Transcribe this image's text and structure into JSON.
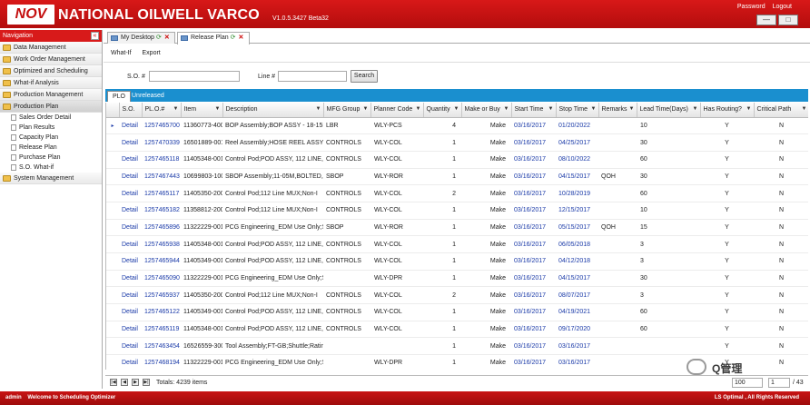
{
  "header": {
    "logo_text": "NOV",
    "company": "NATIONAL OILWELL VARCO",
    "version": "V1.0.5.3427 Beta32",
    "links": [
      "Password",
      "Logout"
    ],
    "window_controls": [
      "—",
      "□"
    ]
  },
  "navigation": {
    "title": "Navigation",
    "collapse": "«",
    "items": [
      {
        "label": "Data Management"
      },
      {
        "label": "Work Order Management"
      },
      {
        "label": "Optimized and Scheduling"
      },
      {
        "label": "What-if Analysis"
      },
      {
        "label": "Production Management"
      },
      {
        "label": "Production Plan",
        "active": true
      }
    ],
    "subitems": [
      "Sales Order Detail",
      "Plan Results",
      "Capacity Plan",
      "Release Plan",
      "Purchase Plan",
      "S.O. What-if"
    ],
    "bottom_item": "System Management"
  },
  "tabs": [
    {
      "label": "My Desktop",
      "refresh": "⟳",
      "close": "✕"
    },
    {
      "label": "Release Plan",
      "refresh": "⟳",
      "close": "✕"
    }
  ],
  "toolbar": {
    "whatif": "What-If",
    "export": "Export"
  },
  "filters": {
    "so_label": "S.O. #",
    "so_value": "",
    "line_label": "Line #",
    "line_value": "",
    "search_button": "Search"
  },
  "subtabs": [
    "PLO",
    "Unreleased"
  ],
  "grid": {
    "columns": [
      "S.O.",
      "PL.O.#",
      "Item",
      "Description",
      "MFG Group",
      "Planner Code",
      "Quantity",
      "Make or Buy",
      "Start Time",
      "Stop Time",
      "Remarks",
      "Lead Time(Days)",
      "Has Routing?",
      "Critical Path"
    ],
    "filter_icon": "▼",
    "rows": [
      [
        "Detail",
        "1257465700",
        "11360773-400",
        "BOP Assembly;BOP ASSY - 18-15M",
        "LBR",
        "WLY-PCS",
        "4",
        "Make",
        "03/16/2017",
        "01/20/2022",
        "",
        "10",
        "Y",
        "N"
      ],
      [
        "Detail",
        "1257470339",
        "16501889-001",
        "Reel Assembly;HOSE REEL ASSY, I",
        "CONTROLS",
        "WLY-COL",
        "1",
        "Make",
        "03/16/2017",
        "04/25/2017",
        "",
        "30",
        "Y",
        "N"
      ],
      [
        "Detail",
        "1257465118",
        "11405348-001",
        "Control Pod;POD ASSY, 112 LINE, I",
        "CONTROLS",
        "WLY-COL",
        "1",
        "Make",
        "03/16/2017",
        "08/10/2022",
        "",
        "60",
        "Y",
        "N"
      ],
      [
        "Detail",
        "1257467443",
        "10699803-100",
        "SBOP Assembly;11-05M,BOLTED,S",
        "SBOP",
        "WLY-ROR",
        "1",
        "Make",
        "03/16/2017",
        "04/15/2017",
        "QOH",
        "30",
        "Y",
        "N"
      ],
      [
        "Detail",
        "1257465117",
        "11405350-200",
        "Control Pod;112 Line MUX;Non-I",
        "CONTROLS",
        "WLY-COL",
        "2",
        "Make",
        "03/16/2017",
        "10/28/2019",
        "",
        "60",
        "Y",
        "N"
      ],
      [
        "Detail",
        "1257465182",
        "11358812-200",
        "Control Pod;112 Line MUX;Non-I",
        "CONTROLS",
        "WLY-COL",
        "1",
        "Make",
        "03/16/2017",
        "12/15/2017",
        "",
        "10",
        "Y",
        "N"
      ],
      [
        "Detail",
        "1257465896",
        "11322229-001",
        "PCG Engineering_EDM Use Only;S",
        "SBOP",
        "WLY-ROR",
        "1",
        "Make",
        "03/16/2017",
        "05/15/2017",
        "QOH",
        "15",
        "Y",
        "N"
      ],
      [
        "Detail",
        "1257465938",
        "11405348-001",
        "Control Pod;POD ASSY, 112 LINE, I",
        "CONTROLS",
        "WLY-COL",
        "1",
        "Make",
        "03/16/2017",
        "06/05/2018",
        "",
        "3",
        "Y",
        "N"
      ],
      [
        "Detail",
        "1257465944",
        "11405349-001",
        "Control Pod;POD ASSY, 112 LINE, I",
        "CONTROLS",
        "WLY-COL",
        "1",
        "Make",
        "03/16/2017",
        "04/12/2018",
        "",
        "3",
        "Y",
        "N"
      ],
      [
        "Detail",
        "1257465090",
        "11322229-001",
        "PCG Engineering_EDM Use Only;S",
        "",
        "WLY-DPR",
        "1",
        "Make",
        "03/16/2017",
        "04/15/2017",
        "",
        "30",
        "Y",
        "N"
      ],
      [
        "Detail",
        "1257465937",
        "11405350-200",
        "Control Pod;112 Line MUX;Non-I",
        "CONTROLS",
        "WLY-COL",
        "2",
        "Make",
        "03/16/2017",
        "08/07/2017",
        "",
        "3",
        "Y",
        "N"
      ],
      [
        "Detail",
        "1257465122",
        "11405349-001",
        "Control Pod;POD ASSY, 112 LINE, I",
        "CONTROLS",
        "WLY-COL",
        "1",
        "Make",
        "03/16/2017",
        "04/19/2021",
        "",
        "60",
        "Y",
        "N"
      ],
      [
        "Detail",
        "1257465119",
        "11405348-001",
        "Control Pod;POD ASSY, 112 LINE, I",
        "CONTROLS",
        "WLY-COL",
        "1",
        "Make",
        "03/16/2017",
        "09/17/2020",
        "",
        "60",
        "Y",
        "N"
      ],
      [
        "Detail",
        "1257463454",
        "16526559-300",
        "Tool Assembly;FT-GB;Shuttle;Rating",
        "",
        "",
        "1",
        "Make",
        "03/16/2017",
        "03/16/2017",
        "",
        "",
        "Y",
        "N"
      ],
      [
        "Detail",
        "1257468194",
        "11322229-001",
        "PCG Engineering_EDM Use Only;S",
        "",
        "WLY-DPR",
        "1",
        "Make",
        "03/16/2017",
        "03/16/2017",
        "",
        "",
        "Y",
        "N"
      ]
    ]
  },
  "pager": {
    "buttons": [
      "|◀",
      "◀",
      "▶",
      "▶|"
    ],
    "totals": "Totals: 4239 items",
    "page_size": "100",
    "page": "1",
    "page_count": "/ 43"
  },
  "footer": {
    "user": "admin",
    "welcome": "Welcome to Scheduling Optimizer",
    "copyright": "LS Optimal , All Rights Reserved"
  },
  "watermark": "Q管理"
}
